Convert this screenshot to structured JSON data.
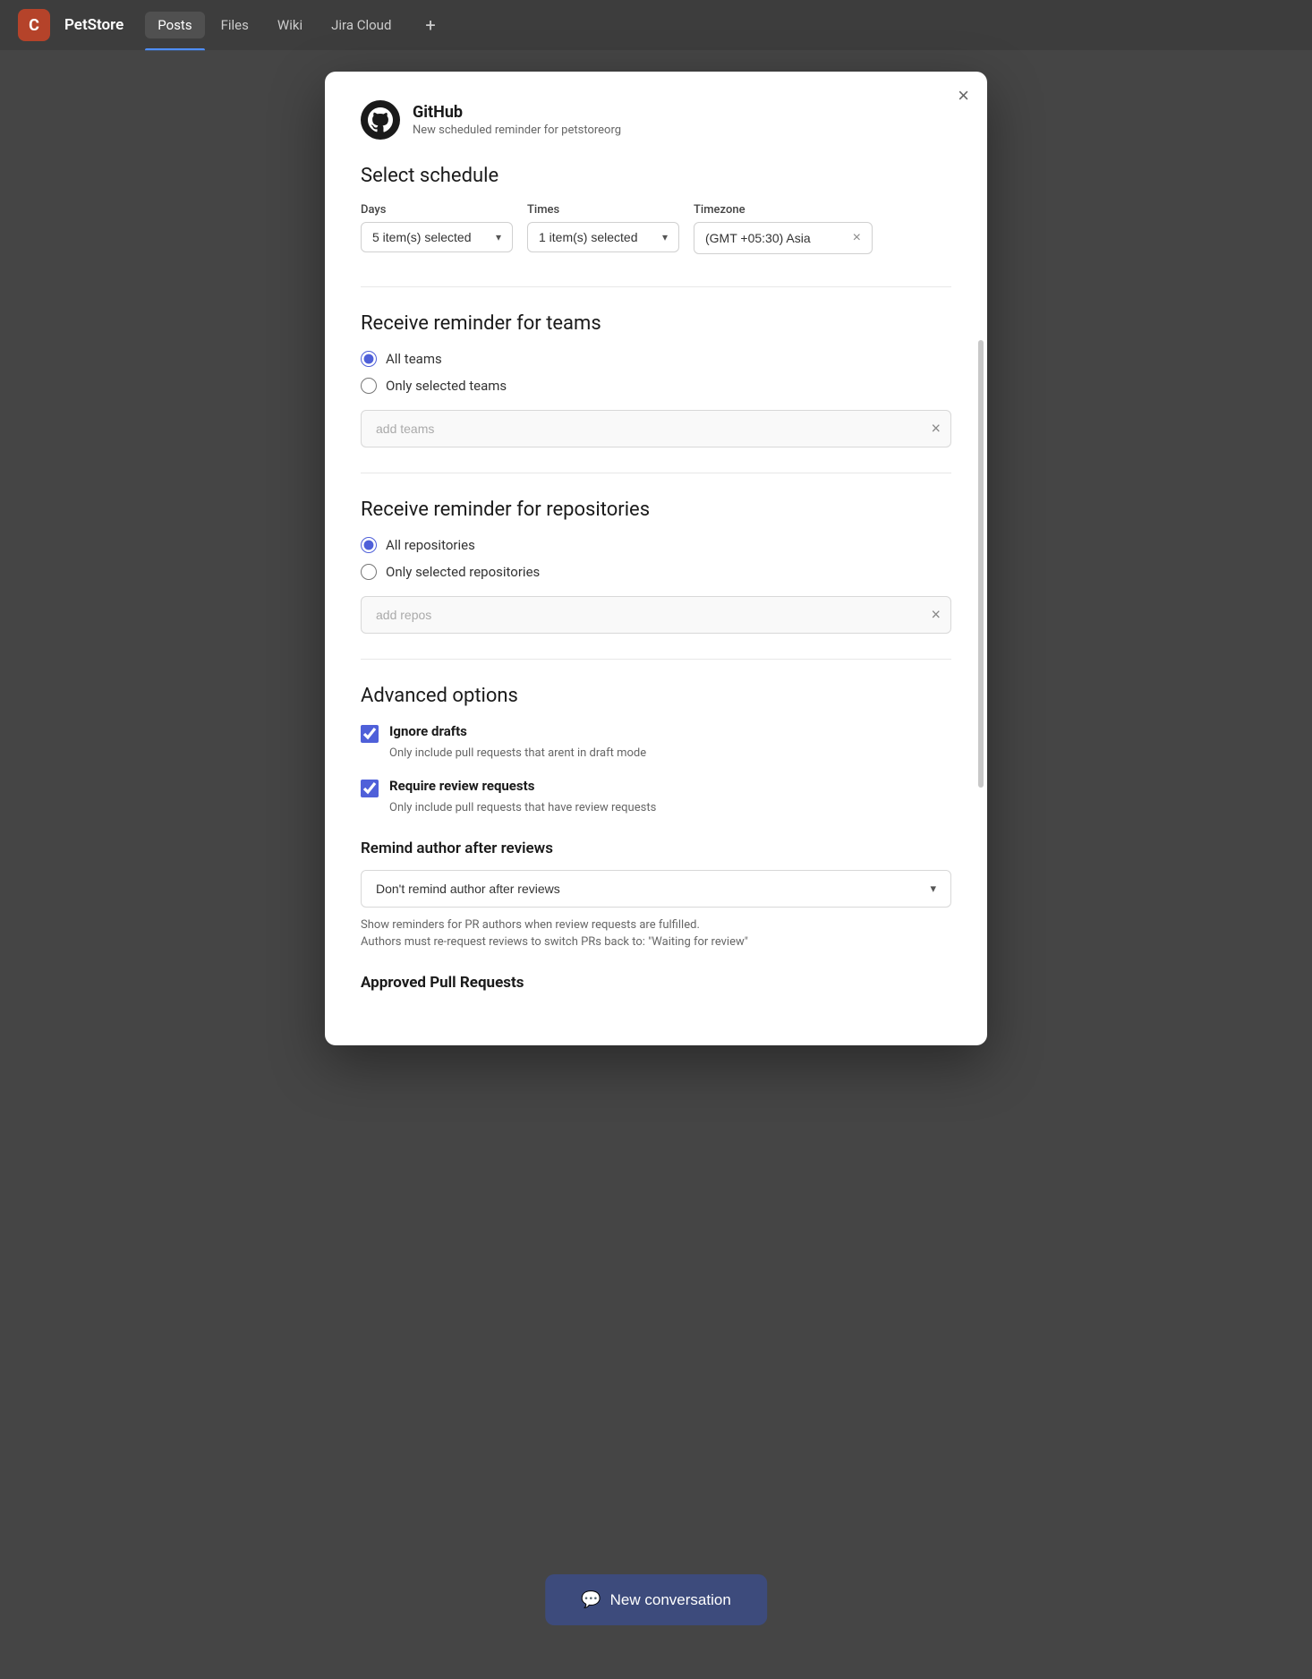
{
  "topbar": {
    "app_icon_letter": "C",
    "app_name": "PetStore",
    "tabs": [
      {
        "id": "posts",
        "label": "Posts",
        "active": true
      },
      {
        "id": "files",
        "label": "Files",
        "active": false
      },
      {
        "id": "wiki",
        "label": "Wiki",
        "active": false
      },
      {
        "id": "jira",
        "label": "Jira Cloud",
        "active": false
      }
    ],
    "add_label": "+"
  },
  "modal": {
    "close_label": "×",
    "github": {
      "title": "GitHub",
      "subtitle": "New scheduled reminder for petstoreorg"
    },
    "schedule": {
      "section_title": "Select schedule",
      "days_label": "Days",
      "days_value": "5 item(s) selected",
      "times_label": "Times",
      "times_value": "1 item(s) selected",
      "timezone_label": "Timezone",
      "timezone_value": "(GMT +05:30) Asia"
    },
    "teams": {
      "section_title": "Receive reminder for teams",
      "options": [
        {
          "id": "all_teams",
          "label": "All teams",
          "checked": true
        },
        {
          "id": "selected_teams",
          "label": "Only selected teams",
          "checked": false
        }
      ],
      "placeholder": "add teams"
    },
    "repositories": {
      "section_title": "Receive reminder for repositories",
      "options": [
        {
          "id": "all_repos",
          "label": "All repositories",
          "checked": true
        },
        {
          "id": "selected_repos",
          "label": "Only selected repositories",
          "checked": false
        }
      ],
      "placeholder": "add repos"
    },
    "advanced": {
      "section_title": "Advanced options",
      "checkboxes": [
        {
          "id": "ignore_drafts",
          "label": "Ignore drafts",
          "description": "Only include pull requests that arent in draft mode",
          "checked": true
        },
        {
          "id": "require_review",
          "label": "Require review requests",
          "description": "Only include pull requests that have review requests",
          "checked": true
        }
      ]
    },
    "remind_author": {
      "section_title": "Remind author after reviews",
      "dropdown_value": "Don't remind author after reviews",
      "notes": [
        "Show reminders for PR authors when review requests are fulfilled.",
        "Authors must re-request reviews to switch PRs back to: \"Waiting for review\""
      ]
    },
    "approved_pr": {
      "section_title": "Approved Pull Requests"
    }
  },
  "bottom": {
    "new_conversation_label": "New conversation",
    "btn_icon": "💬"
  }
}
